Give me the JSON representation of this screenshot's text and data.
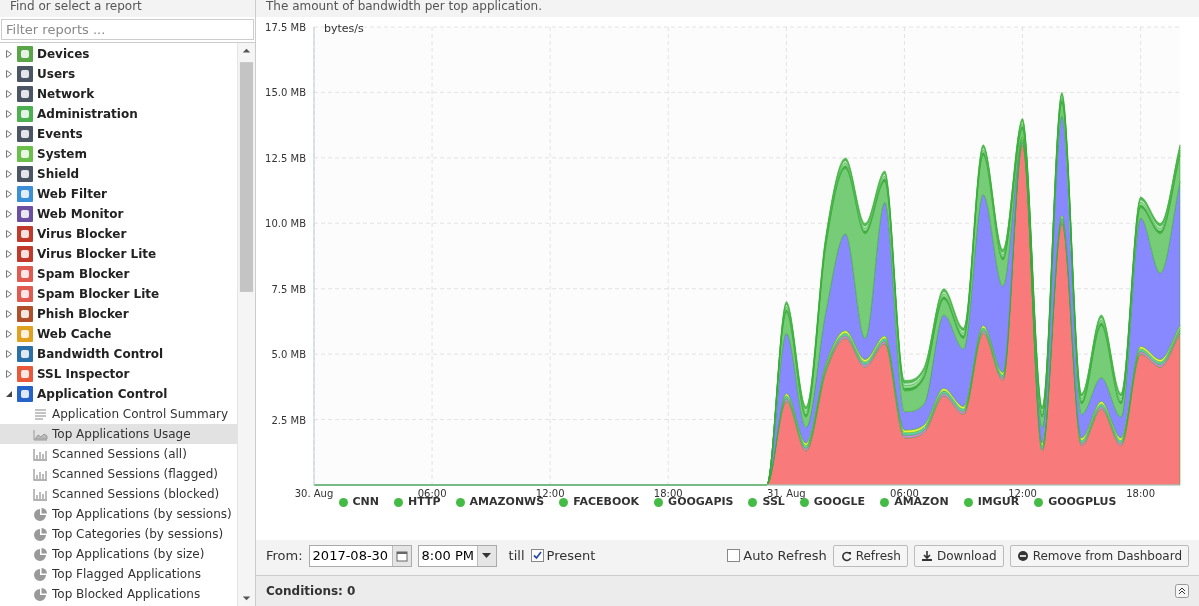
{
  "sidebar": {
    "title": "Find or select a report",
    "filter": {
      "placeholder": "Filter reports ..."
    },
    "items": [
      {
        "label": "Devices",
        "expanded": false
      },
      {
        "label": "Users",
        "expanded": false
      },
      {
        "label": "Network",
        "expanded": false
      },
      {
        "label": "Administration",
        "expanded": false
      },
      {
        "label": "Events",
        "expanded": false
      },
      {
        "label": "System",
        "expanded": false
      },
      {
        "label": "Shield",
        "expanded": false
      },
      {
        "label": "Web Filter",
        "expanded": false
      },
      {
        "label": "Web Monitor",
        "expanded": false
      },
      {
        "label": "Virus Blocker",
        "expanded": false
      },
      {
        "label": "Virus Blocker Lite",
        "expanded": false
      },
      {
        "label": "Spam Blocker",
        "expanded": false
      },
      {
        "label": "Spam Blocker Lite",
        "expanded": false
      },
      {
        "label": "Phish Blocker",
        "expanded": false
      },
      {
        "label": "Web Cache",
        "expanded": false
      },
      {
        "label": "Bandwidth Control",
        "expanded": false
      },
      {
        "label": "SSL Inspector",
        "expanded": false
      },
      {
        "label": "Application Control",
        "expanded": true,
        "children": [
          {
            "label": "Application Control Summary",
            "kind": "text",
            "selected": false
          },
          {
            "label": "Top Applications Usage",
            "kind": "area",
            "selected": true
          },
          {
            "label": "Scanned Sessions (all)",
            "kind": "bar",
            "selected": false
          },
          {
            "label": "Scanned Sessions (flagged)",
            "kind": "bar",
            "selected": false
          },
          {
            "label": "Scanned Sessions (blocked)",
            "kind": "bar",
            "selected": false
          },
          {
            "label": "Top Applications (by sessions)",
            "kind": "pie",
            "selected": false
          },
          {
            "label": "Top Categories (by sessions)",
            "kind": "pie",
            "selected": false
          },
          {
            "label": "Top Applications (by size)",
            "kind": "pie",
            "selected": false
          },
          {
            "label": "Top Flagged Applications",
            "kind": "pie",
            "selected": false
          },
          {
            "label": "Top Blocked Applications",
            "kind": "pie",
            "selected": false
          }
        ]
      }
    ]
  },
  "report": {
    "description": "The amount of bandwidth per top application.",
    "chart_data": {
      "type": "area",
      "stacked": true,
      "grid": true,
      "ylabel": "bytes/s",
      "xlim": [
        "2017-08-30T00:00",
        "2017-08-31T20:00"
      ],
      "ylim": [
        0,
        17.5
      ],
      "xticks": [
        {
          "value": "2017-08-30T00:00",
          "label": "30. Aug"
        },
        {
          "value": "2017-08-30T06:00",
          "label": "06:00"
        },
        {
          "value": "2017-08-30T12:00",
          "label": "12:00"
        },
        {
          "value": "2017-08-30T18:00",
          "label": "18:00"
        },
        {
          "value": "2017-08-31T00:00",
          "label": "31. Aug"
        },
        {
          "value": "2017-08-31T06:00",
          "label": "06:00"
        },
        {
          "value": "2017-08-31T12:00",
          "label": "12:00"
        },
        {
          "value": "2017-08-31T18:00",
          "label": "18:00"
        }
      ],
      "yticks": [
        {
          "value": 2.5,
          "label": "2.5 MB"
        },
        {
          "value": 5,
          "label": "5.0 MB"
        },
        {
          "value": 7.5,
          "label": "7.5 MB"
        },
        {
          "value": 10,
          "label": "10.0 MB"
        },
        {
          "value": 12.5,
          "label": "12.5 MB"
        },
        {
          "value": 15,
          "label": "15.0 MB"
        },
        {
          "value": 17.5,
          "label": "17.5 MB"
        }
      ],
      "x": [
        "2017-08-30T00:00",
        "2017-08-30T23:00",
        "2017-08-31T00:00",
        "2017-08-31T01:00",
        "2017-08-31T02:00",
        "2017-08-31T03:00",
        "2017-08-31T04:00",
        "2017-08-31T05:00",
        "2017-08-31T06:00",
        "2017-08-31T07:00",
        "2017-08-31T08:00",
        "2017-08-31T09:00",
        "2017-08-31T10:00",
        "2017-08-31T11:00",
        "2017-08-31T12:00",
        "2017-08-31T13:00",
        "2017-08-31T14:00",
        "2017-08-31T15:00",
        "2017-08-31T16:00",
        "2017-08-31T17:00",
        "2017-08-31T18:00",
        "2017-08-31T19:00",
        "2017-08-31T20:00"
      ],
      "series": [
        {
          "name": "CNN",
          "color": "#f87a7a",
          "values": [
            0,
            0,
            3.2,
            1.3,
            4.3,
            5.6,
            4.5,
            5.4,
            1.8,
            2.0,
            3.4,
            2.7,
            5.8,
            4.0,
            13.0,
            1.3,
            10.0,
            1.5,
            2.9,
            1.5,
            5.0,
            4.5,
            5.8
          ]
        },
        {
          "name": "HTTP",
          "color": "#e080e0",
          "values": [
            0,
            0,
            0.1,
            0.1,
            0.1,
            0.1,
            0.1,
            0.1,
            0.1,
            0.1,
            0.1,
            0.1,
            0.1,
            0.1,
            0.1,
            0.1,
            0.1,
            0.1,
            0.1,
            0.1,
            0.1,
            0.1,
            0.1
          ]
        },
        {
          "name": "AMAZONWS",
          "color": "#60d0b0",
          "values": [
            0,
            0,
            0.1,
            0.1,
            0.1,
            0.1,
            0.1,
            0.1,
            0.1,
            0.1,
            0.1,
            0.1,
            0.1,
            0.1,
            0.1,
            0.1,
            0.1,
            0.1,
            0.1,
            0.1,
            0.1,
            0.1,
            0.1
          ]
        },
        {
          "name": "FACEBOOK",
          "color": "#f0f040",
          "values": [
            0,
            0,
            0.1,
            0.1,
            0.1,
            0.1,
            0.1,
            0.1,
            0.1,
            0.1,
            0.1,
            0.1,
            0.1,
            0.1,
            0.1,
            0.1,
            0.1,
            0.1,
            0.1,
            0.1,
            0.1,
            0.1,
            0.1
          ]
        },
        {
          "name": "GOOGAPIS",
          "color": "#8888ff",
          "values": [
            0,
            0,
            2.3,
            0.6,
            2.0,
            3.7,
            0.8,
            5.1,
            0.7,
            0.8,
            2.8,
            2.2,
            5.0,
            3.3,
            0,
            0.6,
            3.8,
            0.9,
            0.9,
            0.8,
            4.9,
            3.3,
            5.5
          ]
        },
        {
          "name": "SSL",
          "color": "#77cc77",
          "values": [
            0,
            0,
            0.8,
            0.4,
            2.5,
            2.5,
            4.0,
            0.8,
            0.8,
            1.0,
            0.6,
            0.4,
            1.5,
            1.0,
            0.3,
            0.4,
            0.5,
            0.4,
            2.0,
            0.5,
            0.4,
            1.5,
            1.0
          ]
        },
        {
          "name": "GOOGLE",
          "color": "#44aa44",
          "values": [
            0,
            0,
            0.1,
            0.1,
            0.1,
            0.1,
            0.1,
            0.1,
            0.1,
            0.1,
            0.1,
            0.1,
            0.1,
            0.1,
            0.1,
            0.1,
            0.1,
            0.1,
            0.1,
            0.1,
            0.1,
            0.1,
            0.1
          ]
        },
        {
          "name": "AMAZON",
          "color": "#99dd99",
          "values": [
            0,
            0,
            0.1,
            0.1,
            0.1,
            0.1,
            0.1,
            0.1,
            0.1,
            0.1,
            0.1,
            0.1,
            0.1,
            0.1,
            0.1,
            0.1,
            0.1,
            0.1,
            0.1,
            0.1,
            0.1,
            0.1,
            0.1
          ]
        },
        {
          "name": "IMGUR",
          "color": "#bbe6bb",
          "values": [
            0,
            0,
            0.1,
            0.1,
            0.1,
            0.1,
            0.1,
            0.1,
            0.1,
            0.1,
            0.1,
            0.1,
            0.1,
            0.1,
            0.1,
            0.1,
            0.1,
            0.1,
            0.1,
            0.1,
            0.1,
            0.1,
            0.1
          ]
        },
        {
          "name": "GOOGPLUS",
          "color": "#55bb55",
          "values": [
            0,
            0,
            0.1,
            0.1,
            0.1,
            0.1,
            0.1,
            0.1,
            0.1,
            0.1,
            0.1,
            0.1,
            0.1,
            0.1,
            0.1,
            0.1,
            0.1,
            0.1,
            0.1,
            0.1,
            0.1,
            0.1,
            0.1
          ]
        }
      ]
    }
  },
  "toolbar": {
    "from_label": "From:",
    "date": "2017-08-30",
    "time": "8:00 PM",
    "till_label": "till",
    "present": {
      "label": "Present",
      "checked": true
    },
    "auto_refresh": {
      "label": "Auto Refresh",
      "checked": false
    },
    "buttons": [
      "Refresh",
      "Download",
      "Remove from Dashboard"
    ]
  },
  "conditions": {
    "label": "Conditions: 0"
  }
}
